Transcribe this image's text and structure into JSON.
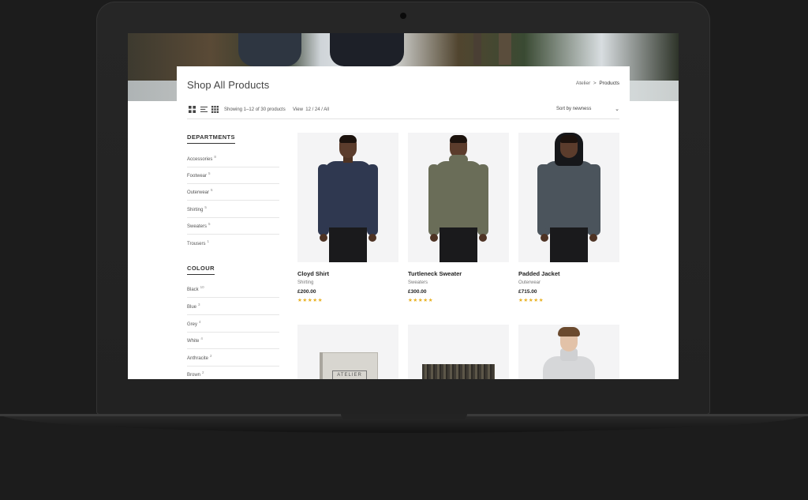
{
  "page": {
    "title": "Shop All Products",
    "breadcrumb": [
      "Atelier",
      "Products"
    ],
    "breadcrumb_sep": ">"
  },
  "toolbar": {
    "showing": "Showing 1–12 of 30 products",
    "view_label": "View",
    "view_options": "12 / 24 / All",
    "sort": "Sort by newness"
  },
  "sidebar": {
    "departments_title": "DEPARTMENTS",
    "departments": [
      {
        "label": "Accessories",
        "count": "8"
      },
      {
        "label": "Footwear",
        "count": "5"
      },
      {
        "label": "Outerwear",
        "count": "5"
      },
      {
        "label": "Shirting",
        "count": "5"
      },
      {
        "label": "Sweaters",
        "count": "5"
      },
      {
        "label": "Trousers",
        "count": "1"
      }
    ],
    "colour_title": "COLOUR",
    "colours": [
      {
        "label": "Black",
        "count": "10"
      },
      {
        "label": "Blue",
        "count": "3"
      },
      {
        "label": "Grey",
        "count": "4"
      },
      {
        "label": "White",
        "count": "4"
      },
      {
        "label": "Anthracite",
        "count": "2"
      },
      {
        "label": "Brown",
        "count": "2"
      }
    ]
  },
  "products": [
    {
      "name": "Cloyd Shirt",
      "category": "Shirting",
      "price": "£200.00",
      "rating": "★★★★★",
      "color": "#2f3850"
    },
    {
      "name": "Turtleneck Sweater",
      "category": "Sweaters",
      "price": "£300.00",
      "rating": "★★★★★",
      "color": "#6a6d58"
    },
    {
      "name": "Padded Jacket",
      "category": "Outerwear",
      "price": "£715.00",
      "rating": "★★★★★",
      "color": "#4b545c"
    }
  ],
  "second_row": [
    {
      "kind": "book",
      "label": "ATELIER"
    },
    {
      "kind": "scarf"
    },
    {
      "kind": "model"
    }
  ],
  "colors": {
    "accent_star": "#e8b020",
    "text": "#222222"
  }
}
